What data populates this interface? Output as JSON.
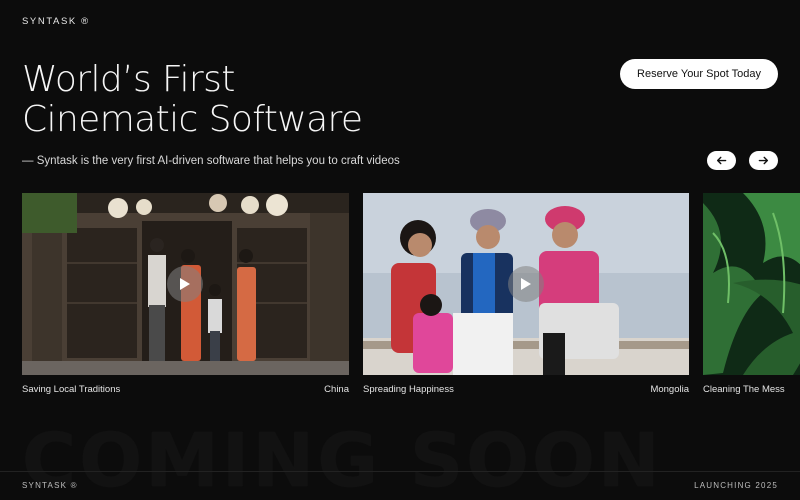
{
  "brand": {
    "logo": "SYNTASK ®"
  },
  "hero": {
    "title_line1": "World’s First",
    "title_line2": "Cinematic Software",
    "tagline": "— Syntask is the very first AI-driven software that helps you to craft videos",
    "cta_label": "Reserve Your Spot Today"
  },
  "carousel": {
    "prev_icon": "arrow-left-icon",
    "next_icon": "arrow-right-icon",
    "cards": [
      {
        "title": "Saving Local Traditions",
        "location": "China",
        "icon": "play-icon"
      },
      {
        "title": "Spreading Happiness",
        "location": "Mongolia",
        "icon": "play-icon"
      },
      {
        "title": "Cleaning The Mess",
        "location": "",
        "icon": ""
      }
    ]
  },
  "background": {
    "watermark": "COMING SOON"
  },
  "footer": {
    "logo": "SYNTASK ®",
    "launch": "LAUNCHING 2025"
  },
  "colors": {
    "background": "#0c0c0c",
    "text": "#f2f2f2",
    "button": "#ffffff"
  }
}
